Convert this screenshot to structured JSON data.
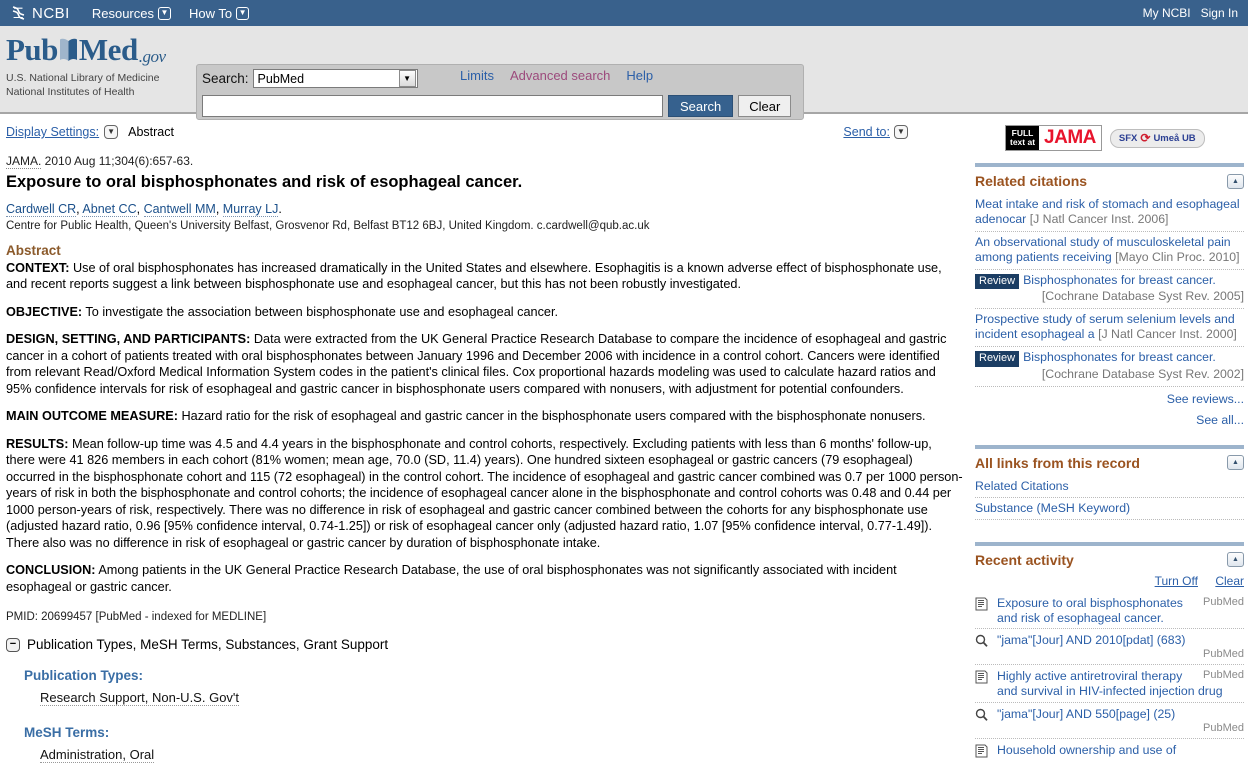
{
  "ncbi_bar": {
    "logo_text": "NCBI",
    "nav": [
      {
        "label": "Resources",
        "icon": "chevron-down-icon"
      },
      {
        "label": "How To",
        "icon": "chevron-down-icon"
      }
    ],
    "my_ncbi": "My NCBI",
    "sign_in": "Sign In"
  },
  "pubmed_header": {
    "wordmark_pub": "Pub",
    "wordmark_med": "Med",
    "wordmark_gov": ".gov",
    "tagline_line1": "U.S. National Library of Medicine",
    "tagline_line2": "National Institutes of Health",
    "search_label": "Search:",
    "database": "PubMed",
    "query_value": "",
    "query_placeholder": "",
    "search_button": "Search",
    "clear_button": "Clear",
    "links": {
      "limits": "Limits",
      "advanced": "Advanced search",
      "help": "Help"
    }
  },
  "toolbar": {
    "display_settings_label": "Display Settings:",
    "display_settings_value": "Abstract",
    "send_to_label": "Send to:"
  },
  "article": {
    "citation": "JAMA. 2010 Aug 11;304(6):657-63.",
    "journal_abbrev": "JAMA.",
    "citation_rest": " 2010 Aug 11;304(6):657-63.",
    "title": "Exposure to oral bisphosphonates and risk of esophageal cancer.",
    "authors": [
      "Cardwell CR",
      "Abnet CC",
      "Cantwell MM",
      "Murray LJ"
    ],
    "affiliation": "Centre for Public Health, Queen's University Belfast, Grosvenor Rd, Belfast BT12 6BJ, United Kingdom. c.cardwell@qub.ac.uk",
    "abstract_heading": "Abstract",
    "abstract_sections": [
      {
        "label": "CONTEXT:",
        "text": " Use of oral bisphosphonates has increased dramatically in the United States and elsewhere. Esophagitis is a known adverse effect of bisphosphonate use, and recent reports suggest a link between bisphosphonate use and esophageal cancer, but this has not been robustly investigated."
      },
      {
        "label": "OBJECTIVE:",
        "text": " To investigate the association between bisphosphonate use and esophageal cancer."
      },
      {
        "label": "DESIGN, SETTING, AND PARTICIPANTS:",
        "text": " Data were extracted from the UK General Practice Research Database to compare the incidence of esophageal and gastric cancer in a cohort of patients treated with oral bisphosphonates between January 1996 and December 2006 with incidence in a control cohort. Cancers were identified from relevant Read/Oxford Medical Information System codes in the patient's clinical files. Cox proportional hazards modeling was used to calculate hazard ratios and 95% confidence intervals for risk of esophageal and gastric cancer in bisphosphonate users compared with nonusers, with adjustment for potential confounders."
      },
      {
        "label": "MAIN OUTCOME MEASURE:",
        "text": " Hazard ratio for the risk of esophageal and gastric cancer in the bisphosphonate users compared with the bisphosphonate nonusers."
      },
      {
        "label": "RESULTS:",
        "text": " Mean follow-up time was 4.5 and 4.4 years in the bisphosphonate and control cohorts, respectively. Excluding patients with less than 6 months' follow-up, there were 41 826 members in each cohort (81% women; mean age, 70.0 (SD, 11.4) years). One hundred sixteen esophageal or gastric cancers (79 esophageal) occurred in the bisphosphonate cohort and 115 (72 esophageal) in the control cohort. The incidence of esophageal and gastric cancer combined was 0.7 per 1000 person-years of risk in both the bisphosphonate and control cohorts; the incidence of esophageal cancer alone in the bisphosphonate and control cohorts was 0.48 and 0.44 per 1000 person-years of risk, respectively. There was no difference in risk of esophageal and gastric cancer combined between the cohorts for any bisphosphonate use (adjusted hazard ratio, 0.96 [95% confidence interval, 0.74-1.25]) or risk of esophageal cancer only (adjusted hazard ratio, 1.07 [95% confidence interval, 0.77-1.49]). There also was no difference in risk of esophageal or gastric cancer by duration of bisphosphonate intake."
      },
      {
        "label": "CONCLUSION:",
        "text": " Among patients in the UK General Practice Research Database, the use of oral bisphosphonates was not significantly associated with incident esophageal or gastric cancer."
      }
    ],
    "pmid_line": "PMID: 20699457 [PubMed - indexed for MEDLINE]",
    "expand_row_label": "Publication Types, MeSH Terms, Substances, Grant Support",
    "publication_types_heading": "Publication Types:",
    "publication_types": [
      "Research Support, Non-U.S. Gov't"
    ],
    "mesh_terms_heading": "MeSH Terms:",
    "mesh_terms": [
      "Administration, Oral"
    ]
  },
  "sidebar": {
    "fulltext": {
      "full_line1": "FULL",
      "full_line2": "text at",
      "journal": "JAMA",
      "sfx_prefix": "SFX",
      "sfx_suffix": "Umeå UB"
    },
    "related_citations": {
      "title": "Related citations",
      "items": [
        {
          "tag": "",
          "title": "Meat intake and risk of stomach and esophageal adenocar",
          "journal": "[J Natl Cancer Inst. 2006]",
          "journal_position": "inline"
        },
        {
          "tag": "",
          "title": "An observational study of musculoskeletal pain among patients receiving",
          "journal": "[Mayo Clin Proc. 2010]",
          "journal_position": "inline"
        },
        {
          "tag": "Review",
          "title": "Bisphosphonates for breast cancer.",
          "journal": "[Cochrane Database Syst Rev. 2005]",
          "journal_position": "right"
        },
        {
          "tag": "",
          "title": "Prospective study of serum selenium levels and incident esophageal a",
          "journal": "[J Natl Cancer Inst. 2000]",
          "journal_position": "inline"
        },
        {
          "tag": "Review",
          "title": "Bisphosphonates for breast cancer.",
          "journal": "[Cochrane Database Syst Rev. 2002]",
          "journal_position": "right"
        }
      ],
      "see_reviews": "See reviews...",
      "see_all": "See all..."
    },
    "all_links": {
      "title": "All links from this record",
      "items": [
        "Related Citations",
        "Substance (MeSH Keyword)"
      ]
    },
    "recent_activity": {
      "title": "Recent activity",
      "turn_off": "Turn Off",
      "clear": "Clear",
      "items": [
        {
          "icon": "document-icon",
          "text": "Exposure to oral bisphosphonates and risk of esophageal cancer.",
          "db": "PubMed",
          "db_position": "inline"
        },
        {
          "icon": "search-icon",
          "text": "\"jama\"[Jour] AND 2010[pdat] (683)",
          "db": "PubMed",
          "db_position": "below"
        },
        {
          "icon": "document-icon",
          "text": "Highly active antiretroviral therapy and survival in HIV-infected injection drug",
          "db": "PubMed",
          "db_position": "inline"
        },
        {
          "icon": "search-icon",
          "text": "\"jama\"[Jour] AND 550[page] (25)",
          "db": "PubMed",
          "db_position": "below"
        },
        {
          "icon": "document-icon",
          "text": "Household ownership and use of",
          "db": "",
          "db_position": "none"
        }
      ]
    }
  },
  "colors": {
    "ncbi_blue": "#39618c",
    "link_blue": "#2b5fa8",
    "panel_heading_brown": "#9a5320",
    "abstract_heading_brown": "#8b5a2b",
    "jama_red": "#e8142c",
    "section_heading_blue": "#3a6ea5",
    "advanced_search_magenta": "#9c4a7c"
  }
}
